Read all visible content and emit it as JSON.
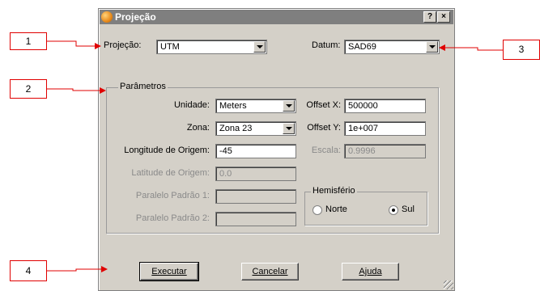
{
  "window": {
    "title": "Projeção",
    "help_btn": "?",
    "close_btn": "×"
  },
  "top": {
    "projecao_label": "Projeção:",
    "projecao_value": "UTM",
    "datum_label": "Datum:",
    "datum_value": "SAD69"
  },
  "parametros": {
    "title": "Parâmetros",
    "unidade_label": "Unidade:",
    "unidade_value": "Meters",
    "zona_label": "Zona:",
    "zona_value": "Zona 23",
    "longitude_label": "Longitude de Origem:",
    "longitude_value": "-45",
    "latitude_label": "Latitude de Origem:",
    "latitude_value": "0.0",
    "paralelo1_label": "Paralelo Padrão 1:",
    "paralelo1_value": "",
    "paralelo2_label": "Paralelo Padrão 2:",
    "paralelo2_value": "",
    "offsetx_label": "Offset X:",
    "offsetx_value": "500000",
    "offsety_label": "Offset Y:",
    "offsety_value": "1e+007",
    "escala_label": "Escala:",
    "escala_value": "0.9996"
  },
  "hemisferio": {
    "title": "Hemisfério",
    "norte": "Norte",
    "sul": "Sul",
    "selected": "Sul"
  },
  "buttons": {
    "executar": "Executar",
    "cancelar": "Cancelar",
    "ajuda": "Ajuda"
  },
  "callouts": [
    "1",
    "2",
    "3",
    "4"
  ],
  "colors": {
    "callout_border": "#e00000",
    "dialog_bg": "#d4d0c8",
    "titlebar_bg": "#7f7f7f"
  }
}
